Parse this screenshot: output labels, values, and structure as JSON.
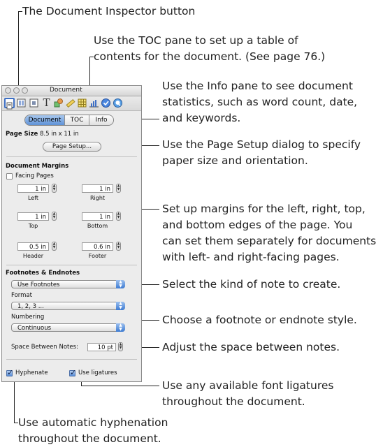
{
  "callouts": {
    "inspector_button": "The Document Inspector button",
    "toc_line1": "Use the TOC pane to set up a table of",
    "toc_line2": "contents for the document. (See page 76.)",
    "info_line1": "Use the Info pane to see document",
    "info_line2": "statistics, such as word count, date,",
    "info_line3": "and keywords.",
    "page_setup_line1": "Use the Page Setup dialog to specify",
    "page_setup_line2": "paper size and orientation.",
    "margins_line1": "Set up margins for the left, right, top,",
    "margins_line2": "and bottom edges of the page. You",
    "margins_line3": "can set them separately for documents",
    "margins_line4": "with left- and right-facing pages.",
    "note_kind": "Select the kind of note to create.",
    "note_style": "Choose a footnote or endnote style.",
    "note_space": "Adjust the space between notes.",
    "ligatures_line1": "Use any available font ligatures",
    "ligatures_line2": "throughout the document.",
    "hyphen_line1": "Use automatic hyphenation",
    "hyphen_line2": "throughout the document."
  },
  "window": {
    "title": "Document"
  },
  "toolbar": {
    "icons": [
      "document-inspector-icon",
      "layout-inspector-icon",
      "wrap-inspector-icon",
      "text-inspector-icon",
      "graphic-inspector-icon",
      "metrics-inspector-icon",
      "table-inspector-icon",
      "chart-inspector-icon",
      "link-inspector-icon",
      "quicktime-inspector-icon"
    ]
  },
  "tabs": [
    {
      "label": "Document",
      "selected": true
    },
    {
      "label": "TOC",
      "selected": false
    },
    {
      "label": "Info",
      "selected": false
    }
  ],
  "page_size": {
    "label": "Page Size",
    "value": "8.5 in x 11 in",
    "button": "Page Setup..."
  },
  "margins": {
    "heading": "Document Margins",
    "facing_pages": "Facing Pages",
    "left": {
      "value": "1 in",
      "label": "Left"
    },
    "right": {
      "value": "1 in",
      "label": "Right"
    },
    "top": {
      "value": "1 in",
      "label": "Top"
    },
    "bottom": {
      "value": "1 in",
      "label": "Bottom"
    },
    "header": {
      "value": "0.5 in",
      "label": "Header"
    },
    "footer": {
      "value": "0.6 in",
      "label": "Footer"
    }
  },
  "notes": {
    "heading": "Footnotes & Endnotes",
    "kind": "Use Footnotes",
    "format_label": "Format",
    "format": "1, 2, 3 ...",
    "numbering_label": "Numbering",
    "numbering": "Continuous",
    "space_label": "Space Between Notes:",
    "space_value": "10 pt"
  },
  "options": {
    "hyphenate": "Hyphenate",
    "hyphenate_checked": true,
    "ligatures": "Use ligatures",
    "ligatures_checked": true
  },
  "colors": {
    "accent": "#5f93d8"
  }
}
